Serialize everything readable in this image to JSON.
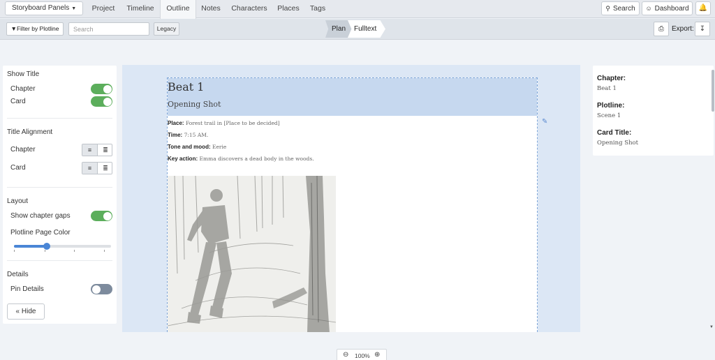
{
  "topbar": {
    "project_menu": "Storyboard Panels",
    "tabs": [
      {
        "label": "Project"
      },
      {
        "label": "Timeline"
      },
      {
        "label": "Outline"
      },
      {
        "label": "Notes"
      },
      {
        "label": "Characters"
      },
      {
        "label": "Places"
      },
      {
        "label": "Tags"
      }
    ],
    "active_tab": "Outline",
    "search_label": "Search",
    "dashboard_label": "Dashboard"
  },
  "toolbar": {
    "filter_label": "Filter by Plotline",
    "search_placeholder": "Search",
    "legacy_label": "Legacy",
    "modes": [
      "Plan",
      "Fulltext"
    ],
    "active_mode": "Fulltext",
    "export_label": "Export:"
  },
  "left_panel": {
    "show_title": {
      "heading": "Show Title",
      "chapter_label": "Chapter",
      "chapter_on": true,
      "card_label": "Card",
      "card_on": true
    },
    "title_alignment": {
      "heading": "Title Alignment",
      "chapter_label": "Chapter",
      "card_label": "Card"
    },
    "layout": {
      "heading": "Layout",
      "show_chapter_gaps_label": "Show chapter gaps",
      "show_chapter_gaps_on": true,
      "plotline_page_color_label": "Plotline Page Color",
      "plotline_page_color_value": 0.34
    },
    "details": {
      "heading": "Details",
      "pin_details_label": "Pin Details",
      "pin_details_on": false
    },
    "hide_label": "Hide"
  },
  "card": {
    "chapter_title": "Beat 1",
    "card_title": "Opening Shot",
    "fields": [
      {
        "label": "Place:",
        "value": "Forest trail in [Place to be decided]"
      },
      {
        "label": "Time:",
        "value": "7:15 AM."
      },
      {
        "label": "Tone and mood:",
        "value": "Eerie"
      },
      {
        "label": "Key action:",
        "value": "Emma discovers a dead body in the woods."
      }
    ]
  },
  "right_panel": {
    "chapter_label": "Chapter:",
    "chapter_value": "Beat 1",
    "plotline_label": "Plotline:",
    "plotline_value": "Scene 1",
    "card_title_label": "Card Title:",
    "card_title_value": "Opening Shot"
  },
  "zoom": {
    "value": "100%"
  },
  "colors": {
    "toggle_on": "#5cae5c",
    "toggle_off": "#7d8b9d",
    "accent": "#4a86d6",
    "canvas_bg": "#dce7f5",
    "card_header_bg": "#c6d8ef"
  }
}
